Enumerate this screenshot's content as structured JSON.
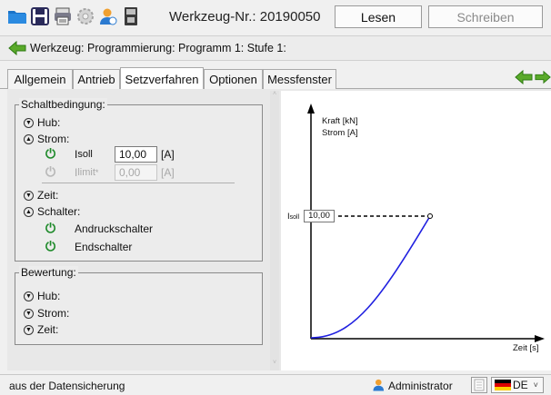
{
  "toolbar": {
    "title": "Werkzeug-Nr.: 20190050",
    "lesen": "Lesen",
    "schreiben": "Schreiben"
  },
  "breadcrumb": "Werkzeug: Programmierung: Programm 1: Stufe 1:",
  "tabs": [
    "Allgemein",
    "Antrieb",
    "Setzverfahren",
    "Optionen",
    "Messfenster"
  ],
  "schaltbedingung": {
    "legend": "Schaltbedingung:",
    "hub": "Hub:",
    "strom": "Strom:",
    "isoll_label_main": "I",
    "isoll_label_sub": "soll",
    "isoll_value": "10,00",
    "isoll_unit": "[A]",
    "ilimit_label_main": "I",
    "ilimit_label_sub": "limit",
    "ilimit_value": "0,00",
    "ilimit_unit": "[A]",
    "zeit": "Zeit:",
    "schalter": "Schalter:",
    "andruck": "Andruckschalter",
    "end": "Endschalter"
  },
  "bewertung": {
    "legend": "Bewertung:",
    "hub": "Hub:",
    "strom": "Strom:",
    "zeit": "Zeit:"
  },
  "diagram": {
    "ylabel1": "Kraft [kN]",
    "ylabel2": "Strom [A]",
    "xlabel": "Zeit [s]",
    "isoll_main": "I",
    "isoll_sub": "soll",
    "isoll_value": "10,00"
  },
  "status": {
    "text": "aus der Datensicherung",
    "user": "Administrator",
    "lang": "DE"
  }
}
